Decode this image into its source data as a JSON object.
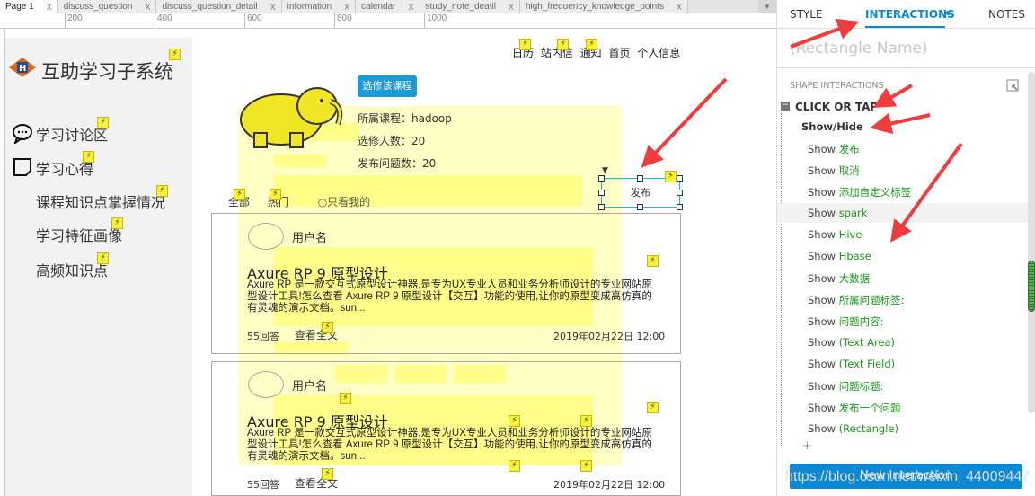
{
  "tabs": [
    {
      "label": "Page 1",
      "active": true
    },
    {
      "label": "discuss_question"
    },
    {
      "label": "discuss_question_detail"
    },
    {
      "label": "information"
    },
    {
      "label": "calendar"
    },
    {
      "label": "study_note_deatil"
    },
    {
      "label": "high_frequency_knowledge_points"
    }
  ],
  "tab_close": "X",
  "ruler": [
    "200",
    "400",
    "600",
    "800",
    "1000"
  ],
  "sidebar": {
    "title": "互助学习子系统",
    "items": [
      "学习讨论区",
      "学习心得",
      "课程知识点掌握情况",
      "学习特征画像",
      "高频知识点"
    ]
  },
  "topnav": "日历 站内信 通知 首页 个人信息",
  "course": {
    "button": "选修该课程",
    "course_label": "所属课程：hadoop",
    "students": "选修人数：20",
    "questions": "发布问题数：20"
  },
  "filters": {
    "all": "全部",
    "hot": "热门",
    "mine": "只看我的"
  },
  "publish": "发布",
  "posts": [
    {
      "user": "用户名",
      "title": "Axure RP 9 原型设计",
      "body": "Axure RP 是一款交互式原型设计神器,是专为UX专业人员和业务分析师设计的专业网站原型设计工具!怎么查看 Axure RP 9 原型设计【交互】功能的使用,让你的原型变成高仿真的有灵魂的演示文档。sun...",
      "answers": "55回答",
      "more": "查看全文",
      "date": "2019年02月22日 12:00"
    },
    {
      "user": "用户名",
      "title": "Axure RP 9 原型设计",
      "body": "Axure RP 是一款交互式原型设计神器,是专为UX专业人员和业务分析师设计的专业网站原型设计工具!怎么查看 Axure RP 9 原型设计【交互】功能的使用,让你的原型变成高仿真的有灵魂的演示文档。sun...",
      "answers": "55回答",
      "more": "查看全文",
      "date": "2019年02月22日 12:00"
    }
  ],
  "panel": {
    "tabs": [
      "STYLE",
      "INTERACTIONS",
      "NOTES"
    ],
    "active_tab": "INTERACTIONS",
    "name_placeholder": "(Rectangle Name)",
    "section": "SHAPE INTERACTIONS",
    "event": "CLICK OR TAP",
    "action": "Show/Hide",
    "show_word": "Show",
    "targets": [
      "发布",
      "取消",
      "添加自定义标签",
      "spark",
      "Hive",
      "Hbase",
      "大数据",
      "所属问题标签:",
      "问题内容:",
      "(Text Area)",
      "(Text Field)",
      "问题标题:",
      "发布一个问题",
      "(Rectangle)"
    ],
    "highlighted_target": "spark",
    "add": "+",
    "new_button": "New Interaction"
  },
  "watermark": "https://blog.csdn.net/weixin_44009447",
  "colors": {
    "accent": "#0a8ad6",
    "target_green": "#1a9a1a",
    "highlight_yellow": "#f7f03c",
    "arrow_red": "#f03c3c"
  }
}
